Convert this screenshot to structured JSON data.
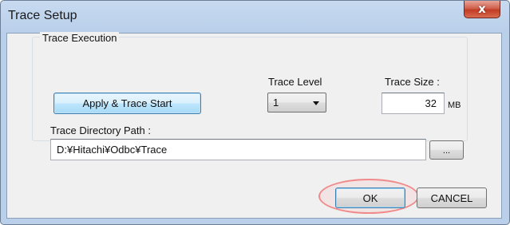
{
  "window": {
    "title": "Trace Setup",
    "close_glyph": "x"
  },
  "trace_execution": {
    "group_label": "Trace Execution",
    "apply_button_label": "Apply & Trace Start",
    "trace_level_label": "Trace Level",
    "trace_level_value": "1",
    "trace_size_label": "Trace Size :",
    "trace_size_value": "32",
    "trace_size_unit": "MB",
    "directory_label": "Trace Directory Path :",
    "directory_value": "D:¥Hitachi¥Odbc¥Trace",
    "browse_button_label": "..."
  },
  "footer": {
    "ok_label": "OK",
    "cancel_label": "CANCEL"
  },
  "annotation": {
    "highlight_color": "#f08a8a"
  }
}
